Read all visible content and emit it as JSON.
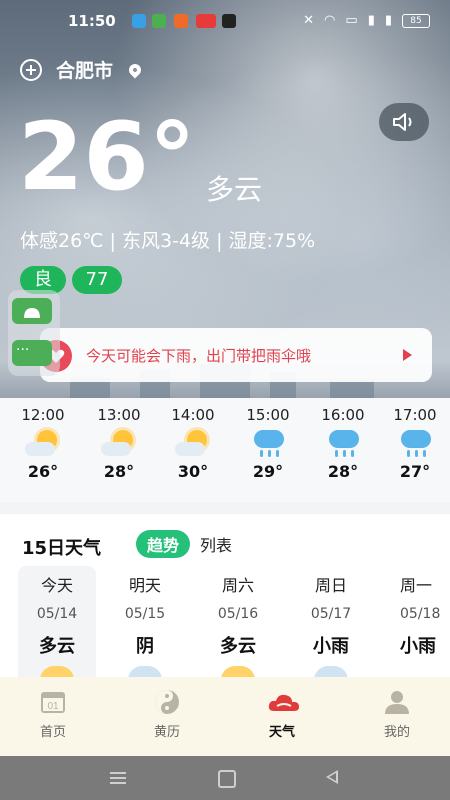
{
  "status_bar": {
    "time": "11:50",
    "battery": "85"
  },
  "location": {
    "city": "合肥市"
  },
  "current": {
    "temperature": "26°",
    "condition": "多云",
    "details": "体感26℃ | 东风3-4级 | 湿度:75%",
    "aqi_label": "良",
    "aqi_value": "77"
  },
  "floating_widget": {
    "bottom_label": "···"
  },
  "alert": {
    "text": "今天可能会下雨，出门带把雨伞哦"
  },
  "hourly": [
    {
      "time": "12:00",
      "icon": "partly-sunny-icon",
      "temp": "26°"
    },
    {
      "time": "13:00",
      "icon": "partly-sunny-icon",
      "temp": "28°"
    },
    {
      "time": "14:00",
      "icon": "partly-sunny-icon",
      "temp": "30°"
    },
    {
      "time": "15:00",
      "icon": "rain-icon",
      "temp": "29°"
    },
    {
      "time": "16:00",
      "icon": "rain-icon",
      "temp": "28°"
    },
    {
      "time": "17:00",
      "icon": "rain-icon",
      "temp": "27°"
    }
  ],
  "forecast": {
    "title": "15日天气",
    "toggle_active": "趋势",
    "toggle_inactive": "列表",
    "days": [
      {
        "name": "今天",
        "date": "05/14",
        "cond": "多云"
      },
      {
        "name": "明天",
        "date": "05/15",
        "cond": "阴"
      },
      {
        "name": "周六",
        "date": "05/16",
        "cond": "多云"
      },
      {
        "name": "周日",
        "date": "05/17",
        "cond": "小雨"
      },
      {
        "name": "周一",
        "date": "05/18",
        "cond": "小雨"
      }
    ]
  },
  "nav": {
    "items": [
      {
        "label": "首页",
        "icon": "calendar-01-icon"
      },
      {
        "label": "黄历",
        "icon": "yin-yang-icon"
      },
      {
        "label": "天气",
        "icon": "weather-cloud-icon"
      },
      {
        "label": "我的",
        "icon": "person-icon"
      }
    ],
    "calendar_number": "01"
  },
  "colors": {
    "accent_green": "#25c07a",
    "aqi_green": "#1fb55b",
    "alert_red": "#e2424f",
    "rain_blue": "#5ab4ec"
  }
}
